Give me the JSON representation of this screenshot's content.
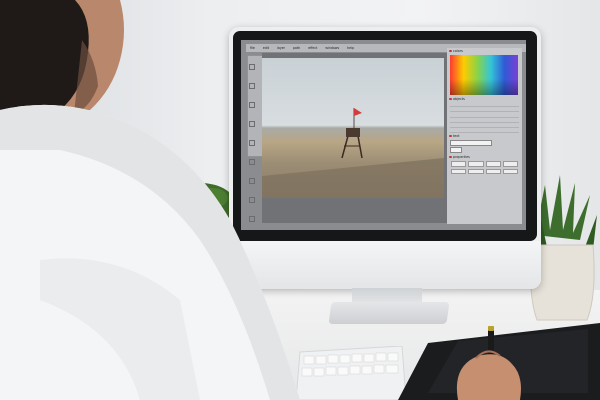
{
  "editor": {
    "menu": [
      "file",
      "edit",
      "layer",
      "path",
      "effect",
      "windows",
      "help"
    ],
    "panels": {
      "colors_title": "colors",
      "objects_title": "objects",
      "text_title": "text",
      "properties_title": "properties"
    }
  },
  "colors": {
    "wall": "#eceef0",
    "desk": "#eeeeee",
    "shirt": "#f4f5f6",
    "editor_bg": "#8a8c8f",
    "accent_dot": "#c0392b"
  },
  "icons": [
    "lifeguard-tower",
    "plant",
    "pen-tablet",
    "stylus",
    "keyboard"
  ]
}
